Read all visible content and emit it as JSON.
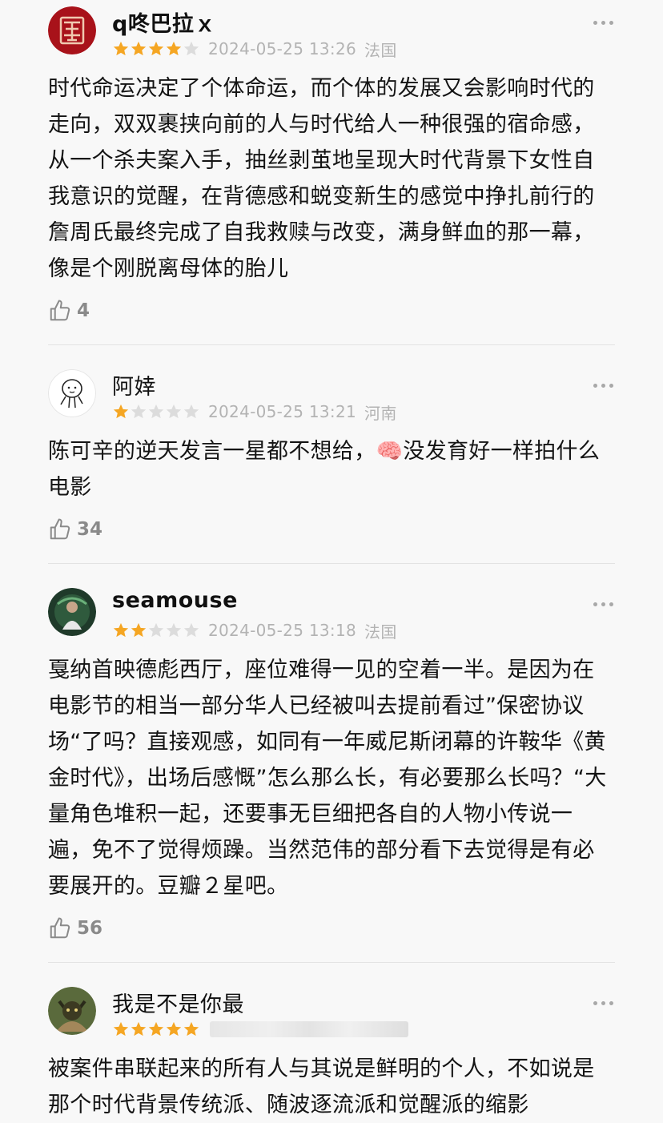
{
  "reviews": [
    {
      "user": "q咚巴拉ｘ",
      "stars": 4,
      "date": "2024-05-25 13:26",
      "location": "法国",
      "text": "时代命运决定了个体命运，而个体的发展又会影响时代的走向，双双裹挟向前的人与时代给人一种很强的宿命感，从一个杀夫案入手，抽丝剥茧地呈现大时代背景下女性自我意识的觉醒，在背德感和蜕变新生的感觉中挣扎前行的詹周氏最终完成了自我救赎与改变，满身鲜血的那一幕，像是个刚脱离母体的胎儿",
      "likes": "4"
    },
    {
      "user": "阿婞",
      "stars": 1,
      "date": "2024-05-25 13:21",
      "location": "河南",
      "text": "陈可辛的逆天发言一星都不想给，🧠没发育好一样拍什么电影",
      "likes": "34"
    },
    {
      "user": "seamouse",
      "stars": 2,
      "date": "2024-05-25 13:18",
      "location": "法国",
      "text": "戛纳首映德彪西厅，座位难得一见的空着一半。是因为在电影节的相当一部分华人已经被叫去提前看过”保密协议场“了吗？直接观感，如同有一年威尼斯闭幕的许鞍华《黄金时代》，出场后感慨”怎么那么长，有必要那么长吗？“大量角色堆积一起，还要事无巨细把各自的人物小传说一遍，免不了觉得烦躁。当然范伟的部分看下去觉得是有必要展开的。豆瓣２星吧。",
      "likes": "56"
    },
    {
      "user": "我是不是你最",
      "stars": 5,
      "date": "",
      "location": "",
      "text": "被案件串联起来的所有人与其说是鲜明的个人，不如说是那个时代背景传统派、随波逐流派和觉醒派的缩影",
      "likes": ""
    }
  ],
  "colors": {
    "star_on": "#f5a623",
    "star_off": "#dcdcdc",
    "meta": "#b3b3b3"
  }
}
